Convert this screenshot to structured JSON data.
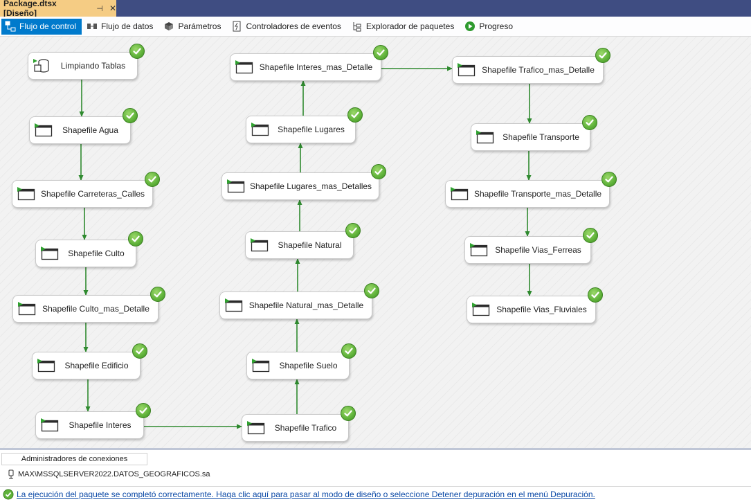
{
  "document_tab": {
    "title": "Package.dtsx [Diseño]",
    "pin_glyph": "⊣",
    "close_glyph": "✕"
  },
  "toolbar": {
    "tabs": [
      {
        "label": "Flujo de control",
        "icon": "control-flow-icon",
        "active": true
      },
      {
        "label": "Flujo de datos",
        "icon": "data-flow-icon",
        "active": false
      },
      {
        "label": "Parámetros",
        "icon": "parameters-icon",
        "active": false
      },
      {
        "label": "Controladores de eventos",
        "icon": "event-handlers-icon",
        "active": false
      },
      {
        "label": "Explorador de paquetes",
        "icon": "package-explorer-icon",
        "active": false
      },
      {
        "label": "Progreso",
        "icon": "progress-icon",
        "active": false
      }
    ]
  },
  "tasks": [
    {
      "id": "limpiando",
      "label": "Limpiando Tablas",
      "icon": "sql-task-icon",
      "status": "success"
    },
    {
      "id": "agua",
      "label": "Shapefile Agua",
      "icon": "shapefile-task-icon",
      "status": "success"
    },
    {
      "id": "carreteras",
      "label": "Shapefile Carreteras_Calles",
      "icon": "shapefile-task-icon",
      "status": "success"
    },
    {
      "id": "culto",
      "label": "Shapefile Culto",
      "icon": "shapefile-task-icon",
      "status": "success"
    },
    {
      "id": "culto_det",
      "label": "Shapefile Culto_mas_Detalle",
      "icon": "shapefile-task-icon",
      "status": "success"
    },
    {
      "id": "edificio",
      "label": "Shapefile Edificio",
      "icon": "shapefile-task-icon",
      "status": "success"
    },
    {
      "id": "interes",
      "label": "Shapefile Interes",
      "icon": "shapefile-task-icon",
      "status": "success"
    },
    {
      "id": "trafico",
      "label": "Shapefile Trafico",
      "icon": "shapefile-task-icon",
      "status": "success"
    },
    {
      "id": "suelo",
      "label": "Shapefile Suelo",
      "icon": "shapefile-task-icon",
      "status": "success"
    },
    {
      "id": "natural_det",
      "label": "Shapefile Natural_mas_Detalle",
      "icon": "shapefile-task-icon",
      "status": "success"
    },
    {
      "id": "natural",
      "label": "Shapefile Natural",
      "icon": "shapefile-task-icon",
      "status": "success"
    },
    {
      "id": "lugares_det",
      "label": "Shapefile Lugares_mas_Detalles",
      "icon": "shapefile-task-icon",
      "status": "success"
    },
    {
      "id": "lugares",
      "label": "Shapefile Lugares",
      "icon": "shapefile-task-icon",
      "status": "success"
    },
    {
      "id": "interes_det",
      "label": "Shapefile Interes_mas_Detalle",
      "icon": "shapefile-task-icon",
      "status": "success"
    },
    {
      "id": "trafico_det",
      "label": "Shapefile Trafico_mas_Detalle",
      "icon": "shapefile-task-icon",
      "status": "success"
    },
    {
      "id": "transporte",
      "label": "Shapefile Transporte",
      "icon": "shapefile-task-icon",
      "status": "success"
    },
    {
      "id": "transporte_det",
      "label": "Shapefile Transporte_mas_Detalle",
      "icon": "shapefile-task-icon",
      "status": "success"
    },
    {
      "id": "vias_ferreas",
      "label": "Shapefile Vias_Ferreas",
      "icon": "shapefile-task-icon",
      "status": "success"
    },
    {
      "id": "vias_fluviales",
      "label": "Shapefile Vias_Fluviales",
      "icon": "shapefile-task-icon",
      "status": "success"
    }
  ],
  "precedence_constraints": [
    [
      "limpiando",
      "agua"
    ],
    [
      "agua",
      "carreteras"
    ],
    [
      "carreteras",
      "culto"
    ],
    [
      "culto",
      "culto_det"
    ],
    [
      "culto_det",
      "edificio"
    ],
    [
      "edificio",
      "interes"
    ],
    [
      "interes",
      "trafico"
    ],
    [
      "trafico",
      "suelo"
    ],
    [
      "suelo",
      "natural_det"
    ],
    [
      "natural_det",
      "natural"
    ],
    [
      "natural",
      "lugares_det"
    ],
    [
      "lugares_det",
      "lugares"
    ],
    [
      "lugares",
      "interes_det"
    ],
    [
      "interes_det",
      "trafico_det"
    ],
    [
      "trafico_det",
      "transporte"
    ],
    [
      "transporte",
      "transporte_det"
    ],
    [
      "transporte_det",
      "vias_ferreas"
    ],
    [
      "vias_ferreas",
      "vias_fluviales"
    ]
  ],
  "colors": {
    "success": "#5fb23a",
    "connector": "#2f8a2f",
    "active_tab": "#007acc",
    "doc_tab": "#f5cc84",
    "tab_strip": "#3f4d82"
  },
  "connection_managers": {
    "header": "Administradores de conexiones",
    "items": [
      {
        "label": "MAX\\MSSQLSERVER2022.DATOS_GEOGRAFICOS.sa",
        "icon": "db-connection-icon"
      }
    ]
  },
  "status_bar": {
    "icon": "info-check-icon",
    "text": "La ejecución del paquete se completó correctamente. Haga clic aquí para pasar al modo de diseño o seleccione Detener depuración en el menú Depuración."
  }
}
